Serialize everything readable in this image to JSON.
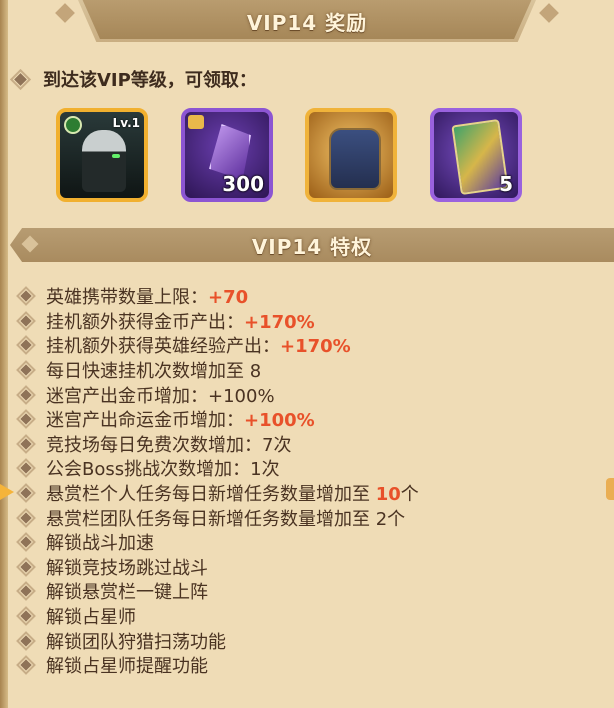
{
  "header": {
    "title": "VIP14 奖励"
  },
  "intro": {
    "text": "到达该VIP等级，可领取："
  },
  "rewards": [
    {
      "name": "hero",
      "level": "Lv.1",
      "icon": "hero-portrait-icon"
    },
    {
      "name": "crystal-shard",
      "count": "300",
      "icon": "crystal-shard-icon"
    },
    {
      "name": "armor",
      "icon": "armor-icon"
    },
    {
      "name": "card",
      "count": "5",
      "icon": "card-icon"
    }
  ],
  "privileges": {
    "title": "VIP14 特权",
    "items": [
      {
        "prefix": "英雄携带数量上限：",
        "value": "+70",
        "suffix": ""
      },
      {
        "prefix": "挂机额外获得金币产出：",
        "value": "+170%",
        "suffix": ""
      },
      {
        "prefix": "挂机额外获得英雄经验产出：",
        "value": "+170%",
        "suffix": ""
      },
      {
        "prefix": "每日快速挂机次数增加至 8",
        "value": "",
        "suffix": ""
      },
      {
        "prefix": "迷宫产出金币增加：+100%",
        "value": "",
        "suffix": ""
      },
      {
        "prefix": "迷宫产出命运金币增加：",
        "value": "+100%",
        "suffix": ""
      },
      {
        "prefix": "竞技场每日免费次数增加：7次",
        "value": "",
        "suffix": ""
      },
      {
        "prefix": "公会Boss挑战次数增加：1次",
        "value": "",
        "suffix": ""
      },
      {
        "prefix": "悬赏栏个人任务每日新增任务数量增加至 ",
        "value": "10",
        "suffix": "个"
      },
      {
        "prefix": "悬赏栏团队任务每日新增任务数量增加至 2个",
        "value": "",
        "suffix": ""
      },
      {
        "prefix": "解锁战斗加速",
        "value": "",
        "suffix": ""
      },
      {
        "prefix": "解锁竞技场跳过战斗",
        "value": "",
        "suffix": ""
      },
      {
        "prefix": "解锁悬赏栏一键上阵",
        "value": "",
        "suffix": ""
      },
      {
        "prefix": "解锁占星师",
        "value": "",
        "suffix": ""
      },
      {
        "prefix": "解锁团队狩猎扫荡功能",
        "value": "",
        "suffix": ""
      },
      {
        "prefix": "解锁占星师提醒功能",
        "value": "",
        "suffix": ""
      }
    ]
  },
  "colors": {
    "highlight": "#e8512a",
    "background": "#efdcb6",
    "banner": "#a98b5f"
  }
}
